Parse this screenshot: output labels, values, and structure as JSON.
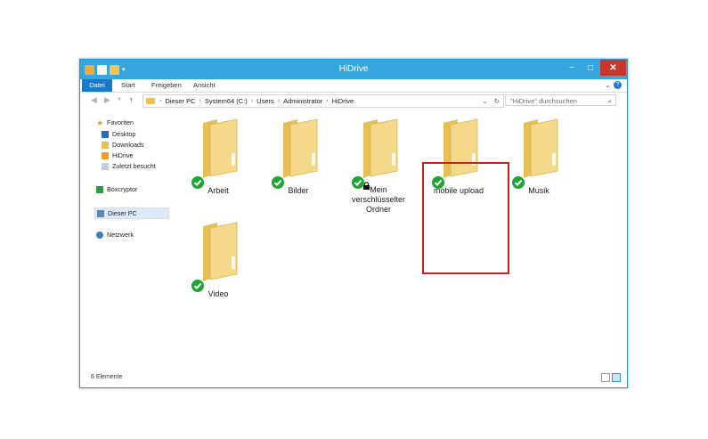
{
  "window": {
    "title": "HiDrive",
    "controls": {
      "minimize": "−",
      "maximize": "□",
      "close": "✕"
    }
  },
  "ribbon": {
    "tabs": [
      "Datei",
      "Start",
      "Freigeben",
      "Ansicht"
    ],
    "expand_icon": "chevron-down-icon",
    "help": "?"
  },
  "address_bar": {
    "segments": [
      "Dieser PC",
      "System64 (C:)",
      "Users",
      "Administrator",
      "HiDrive"
    ],
    "refresh_icon": "refresh-icon",
    "search_placeholder": "\"HiDrive\" durchsuchen"
  },
  "sidebar": {
    "favorites_label": "Favoriten",
    "favorites": [
      "Desktop",
      "Downloads",
      "HiDrive",
      "Zuletzt besucht"
    ],
    "boxcryptor": "Boxcryptor",
    "this_pc": "Dieser PC",
    "network": "Netzwerk"
  },
  "folders": [
    {
      "name": "Arbeit",
      "status": "synced"
    },
    {
      "name": "Bilder",
      "status": "synced"
    },
    {
      "name": "Mein verschlüsselter Ordner",
      "lines": [
        "Mein",
        "verschlüsselter",
        "Ordner"
      ],
      "status": "synced-encrypted",
      "highlighted": true
    },
    {
      "name": "mobile upload",
      "status": "synced"
    },
    {
      "name": "Musik",
      "status": "synced"
    },
    {
      "name": "Video",
      "status": "synced"
    }
  ],
  "status_bar": {
    "count": "6 Elemente"
  },
  "colors": {
    "titlebar": "#36a6df",
    "file_tab": "#1979ca",
    "close_button": "#c7372b",
    "sync_check": "#1fa532",
    "highlight_border": "#cc1f1f",
    "folder": "#f2d27a"
  }
}
